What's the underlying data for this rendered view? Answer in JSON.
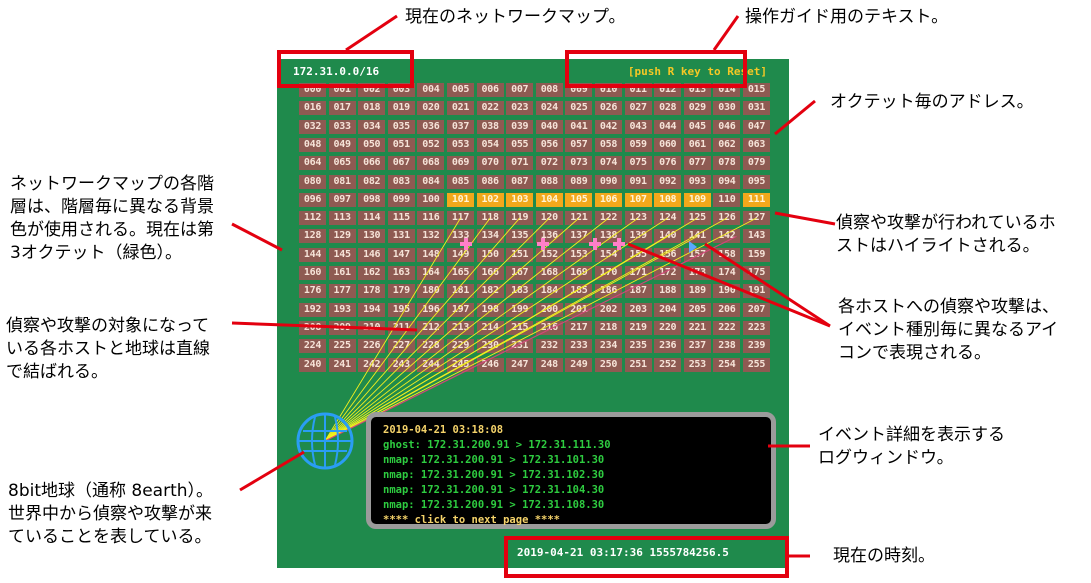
{
  "panel": {
    "network_label": "172.31.0.0/16",
    "guide_text": "[push R key to Reset]",
    "clock": "2019-04-21 03:17:36 1555784256.5",
    "highlighted": [
      101,
      102,
      103,
      104,
      105,
      106,
      107,
      108,
      109,
      111
    ],
    "log": {
      "time": "2019-04-21 03:18:08",
      "lines": [
        "ghost: 172.31.200.91 > 172.31.111.30",
        "nmap: 172.31.200.91 > 172.31.101.30",
        "nmap: 172.31.200.91 > 172.31.102.30",
        "nmap: 172.31.200.91 > 172.31.104.30",
        "nmap: 172.31.200.91 > 172.31.108.30"
      ],
      "next": "**** click to next page ****"
    }
  },
  "annotations": {
    "current_map": "現在のネットワークマップ。",
    "guide": "操作ガイド用のテキスト。",
    "octet": "オクテット毎のアドレス。",
    "layer_bg": [
      "ネットワークマップの各階",
      "層は、階層毎に異なる背景",
      "色が使用される。現在は第",
      "3オクテット（緑色）。"
    ],
    "highlight": [
      "偵察や攻撃が行われているホ",
      "ストはハイライトされる。"
    ],
    "icons": [
      "各ホストへの偵察や攻撃は、",
      "イベント種別毎に異なるアイ",
      "コンで表現される。"
    ],
    "lines": [
      "偵察や攻撃の対象になって",
      "いる各ホストと地球は直線",
      "で結ばれる。"
    ],
    "event_log": [
      "イベント詳細を表示する",
      "ログウィンドウ。"
    ],
    "earth": [
      "8bit地球（通称 8earth）。",
      "世界中から偵察や攻撃が来",
      "ていることを表している。"
    ],
    "clock": "現在の時刻。"
  }
}
